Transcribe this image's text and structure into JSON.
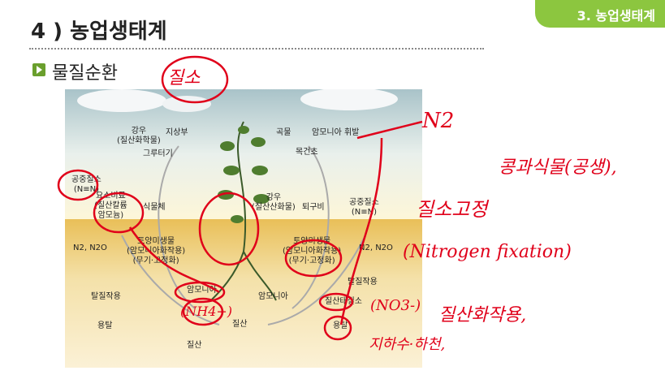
{
  "header": {
    "section_tab": "3. 농업생태계",
    "title": "4 ) 농업생태계",
    "subtitle": "물질순환"
  },
  "diagram": {
    "labels": {
      "rain": "강우\n(질산화학물)",
      "above": "지상부",
      "grain": "곡물",
      "ammonia_volatilization": "암모니아 휘발",
      "stubble": "그루터기",
      "livestock": "목건초",
      "air_n_left": "공중질소\n(N≡N)",
      "urea": "요소비료\n(질산칼륨\n암모늄)",
      "plant_body": "식물체",
      "rain2": "강우\n(질산산화물)",
      "compost": "퇴구비",
      "air_n_right": "공중질소\n(N≡N)",
      "n2_left": "N2, N2O",
      "soil_microbes_left": "토양미생물\n(암모니아화작용)\n(무기·고정화)",
      "soil_microbes_right": "토양미생물\n(암모니아화작용)\n(무기·고정화)",
      "n2_right": "N2, N2O",
      "denitrification": "탈질작용",
      "ammonia": "암모니아",
      "ammonia2": "암모니아",
      "nitrification": "질산태질소",
      "fixation": "탈질작용",
      "leach_left": "용탈",
      "leach_right": "용탈",
      "nitrate_left": "질산",
      "nitrate_bottom": "질산"
    }
  },
  "annotations": {
    "nitrogen_circle": "질소",
    "n2": "N2",
    "legume": "콩과식물(공생),",
    "fixation_ko": "질소고정",
    "fixation_en": "(Nitrogen fixation)",
    "nh4": "(NH4+)",
    "no3": "(NO3-)",
    "leach_note": "질산화작용,",
    "leach_note2": "지하수·하천,"
  }
}
